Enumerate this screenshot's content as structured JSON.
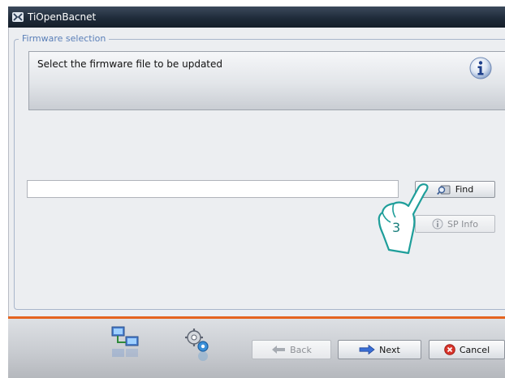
{
  "window": {
    "title": "TiOpenBacnet"
  },
  "group": {
    "legend": "Firmware selection"
  },
  "info": {
    "message": "Select the firmware file to be updated",
    "icon": "info-icon"
  },
  "file": {
    "value": "",
    "placeholder": ""
  },
  "buttons": {
    "find": "Find",
    "sp_info": "SP Info",
    "back": "Back",
    "next": "Next",
    "cancel": "Cancel"
  },
  "step_marker": {
    "label": "3"
  },
  "bottom_icons": [
    "network-computers-icon",
    "settings-gears-icon"
  ],
  "colors": {
    "title_bar": "#1f2b3a",
    "accent_orange": "#e4641f",
    "legend_blue": "#5a7fb8"
  }
}
